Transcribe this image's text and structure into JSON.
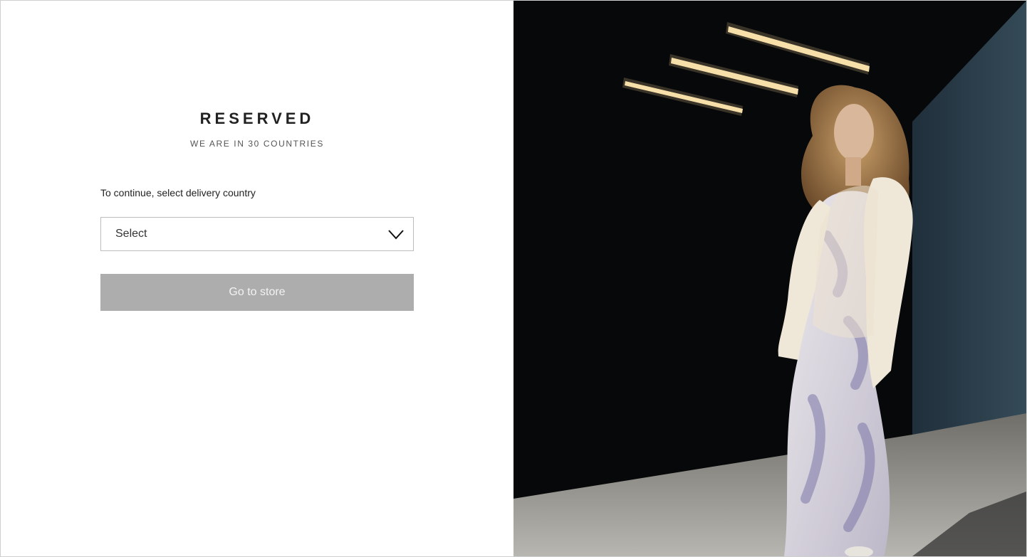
{
  "brand": {
    "name": "RESERVED",
    "tagline": "WE ARE IN 30 COUNTRIES"
  },
  "form": {
    "prompt": "To continue, select delivery country",
    "select_value": "Select",
    "submit_label": "Go to store",
    "submit_disabled": true
  },
  "colors": {
    "button_disabled": "#adadad",
    "text": "#1e1e1e",
    "hero_background": "#060608"
  },
  "icons": {
    "select_chevron": "chevron-down-icon"
  }
}
